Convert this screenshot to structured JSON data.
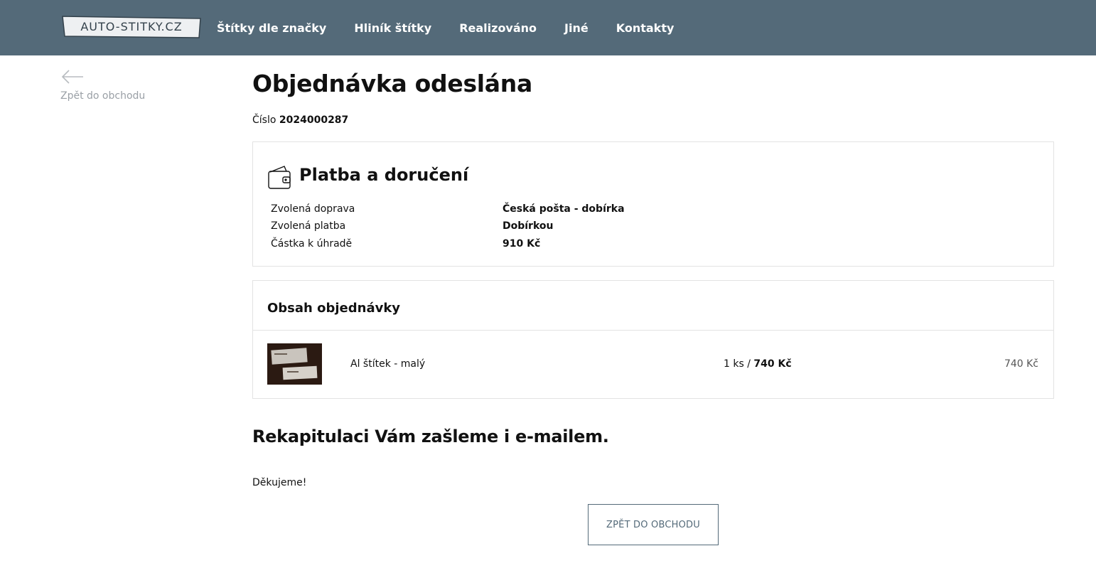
{
  "header": {
    "logo_text": "AUTO-STITKY.CZ",
    "nav": [
      "Štítky dle značky",
      "Hliník štítky",
      "Realizováno",
      "Jiné",
      "Kontakty"
    ]
  },
  "back_link": {
    "icon": "arrow-left-icon",
    "label": "Zpět do obchodu"
  },
  "page_title": "Objednávka odeslána",
  "order": {
    "label": "Číslo",
    "number": "2024000287"
  },
  "payment": {
    "icon": "wallet-icon",
    "title": "Platba a doručení",
    "rows": [
      {
        "label": "Zvolená doprava",
        "value": "Česká pošta - dobírka"
      },
      {
        "label": "Zvolená platba",
        "value": "Dobírkou"
      },
      {
        "label": "Částka k úhradě",
        "value": "910 Kč"
      }
    ]
  },
  "order_content": {
    "title": "Obsah objednávky",
    "items": [
      {
        "name": "Al štítek - malý",
        "qty": "1 ks",
        "unit_price": "740 Kč",
        "total": "740 Kč"
      }
    ]
  },
  "recap_text": "Rekapitulaci Vám zašleme i e-mailem.",
  "thanks_text": "Děkujeme!",
  "back_button": "Zpět do obchodu",
  "colors": {
    "header_bg": "#546a79",
    "button_border": "#546a79"
  }
}
